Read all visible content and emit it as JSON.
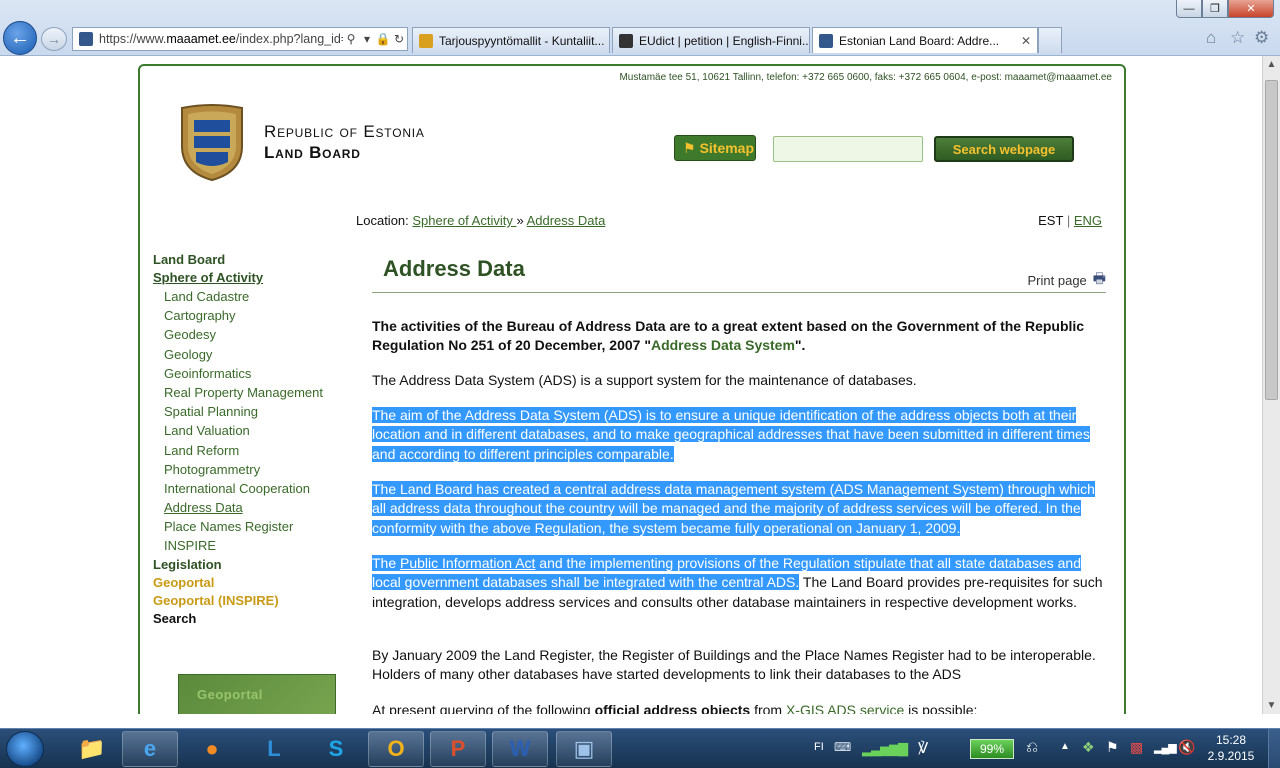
{
  "browser": {
    "address": {
      "prefix": "https://www.",
      "domain": "maaamet.ee",
      "rest": "/index.php?lang_id="
    },
    "tabs": [
      {
        "title": "Tarjouspyyntömallit - Kuntaliit...",
        "color": "#d9a020"
      },
      {
        "title": "EUdict | petition | English-Finni...",
        "color": "#333333"
      },
      {
        "title": "Estonian Land Board: Addre...",
        "color": "#35588c"
      }
    ],
    "controls": {
      "min": "—",
      "max": "❐",
      "close": "✕"
    }
  },
  "site": {
    "contact": "Mustamäe tee 51, 10621 Tallinn, telefon: +372 665 0600, faks: +372 665 0604, e-post: maaamet@maaamet.ee",
    "org_line1": "Republic of Estonia",
    "org_line2": "Land Board",
    "sitemap_label": "Sitemap",
    "search_value": "",
    "search_button": "Search webpage",
    "breadcrumb": {
      "prefix": "Location:",
      "item1": "Sphere of Activity ",
      "sep": "»",
      "item2": "Address Data"
    },
    "lang": {
      "est": "EST",
      "sep": "|",
      "eng": "ENG"
    },
    "banner_text": "Geoportal"
  },
  "sidebar": {
    "land_board": "Land Board",
    "sphere": "Sphere of Activity",
    "sub": [
      "Land Cadastre",
      "Cartography",
      "Geodesy",
      "Geology",
      "Geoinformatics",
      "Real Property Management",
      "Spatial Planning",
      "Land Valuation",
      "Land Reform",
      "Photogrammetry",
      "International Cooperation",
      "Address Data",
      "Place Names Register",
      "INSPIRE"
    ],
    "legislation": "Legislation",
    "geoportal": "Geoportal",
    "geoportal_inspire": "Geoportal (INSPIRE)",
    "search": "Search"
  },
  "article": {
    "title": "Address Data",
    "print": "Print page",
    "p1_a": "The activities of the Bureau of Address Data are to a great extent based on the Government of the Republic Regulation No 251 of 20 December, 2007 \"",
    "p1_link": "Address Data System",
    "p1_b": "\".",
    "p2": "The Address Data System (ADS) is a support system for the maintenance of databases.",
    "p3": "The aim of the Address Data System (ADS) is to ensure a unique identification of the address objects both at their location and in different databases, and to make geographical addresses that have been submitted in different times and according to different principles comparable.",
    "p4": "The Land Board has created a central address data management system (ADS Management System) through which all address data throughout the country will be managed and the majority of address services will be offered. In the conformity with the above Regulation, the system became fully operational on January 1, 2009.",
    "p5_a": "The ",
    "p5_link": "Public Information Act",
    "p5_b": " and the implementing provisions of the Regulation stipulate that all state databases and local government databases shall be integrated with the central ADS.",
    "p5_c": " The Land Board provides pre-requisites for such integration, develops address services and consults other database maintainers in respective development works.",
    "p6": "By January 2009 the Land Register, the Register of Buildings and the Place Names Register had to be interoperable. Holders of many other databases have started developments to link their databases to the ADS",
    "p7_a": "At present querying of the following ",
    "p7_bold": "official address objects",
    "p7_b": " from ",
    "p7_link": "X-GIS ADS service",
    "p7_c": " is possible:"
  },
  "taskbar": {
    "apps": [
      "explorer",
      "internet-explorer",
      "firefox",
      "lync",
      "skype",
      "outlook",
      "powerpoint",
      "word",
      "remote-desktop"
    ],
    "lang": "FI",
    "battery": "99%",
    "time": "15:28",
    "date": "2.9.2015"
  }
}
